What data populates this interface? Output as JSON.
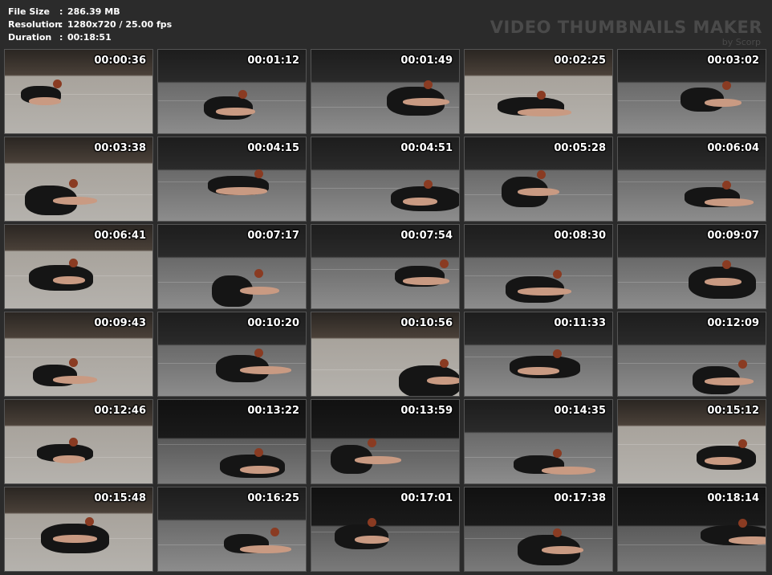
{
  "meta": {
    "file_size_label": "File Size",
    "file_size_value": "286.39 MB",
    "resolution_label": "Resolution",
    "resolution_value": "1280x720 / 25.00 fps",
    "duration_label": "Duration",
    "duration_value": "00:18:51",
    "separator": ":"
  },
  "watermark": {
    "title": "VIDEO THUMBNAILS MAKER",
    "subtitle": "by Scorp"
  },
  "thumbnails": [
    {
      "time": "00:00:36"
    },
    {
      "time": "00:01:12"
    },
    {
      "time": "00:01:49"
    },
    {
      "time": "00:02:25"
    },
    {
      "time": "00:03:02"
    },
    {
      "time": "00:03:38"
    },
    {
      "time": "00:04:15"
    },
    {
      "time": "00:04:51"
    },
    {
      "time": "00:05:28"
    },
    {
      "time": "00:06:04"
    },
    {
      "time": "00:06:41"
    },
    {
      "time": "00:07:17"
    },
    {
      "time": "00:07:54"
    },
    {
      "time": "00:08:30"
    },
    {
      "time": "00:09:07"
    },
    {
      "time": "00:09:43"
    },
    {
      "time": "00:10:20"
    },
    {
      "time": "00:10:56"
    },
    {
      "time": "00:11:33"
    },
    {
      "time": "00:12:09"
    },
    {
      "time": "00:12:46"
    },
    {
      "time": "00:13:22"
    },
    {
      "time": "00:13:59"
    },
    {
      "time": "00:14:35"
    },
    {
      "time": "00:15:12"
    },
    {
      "time": "00:15:48"
    },
    {
      "time": "00:16:25"
    },
    {
      "time": "00:17:01"
    },
    {
      "time": "00:17:38"
    },
    {
      "time": "00:18:14"
    }
  ]
}
